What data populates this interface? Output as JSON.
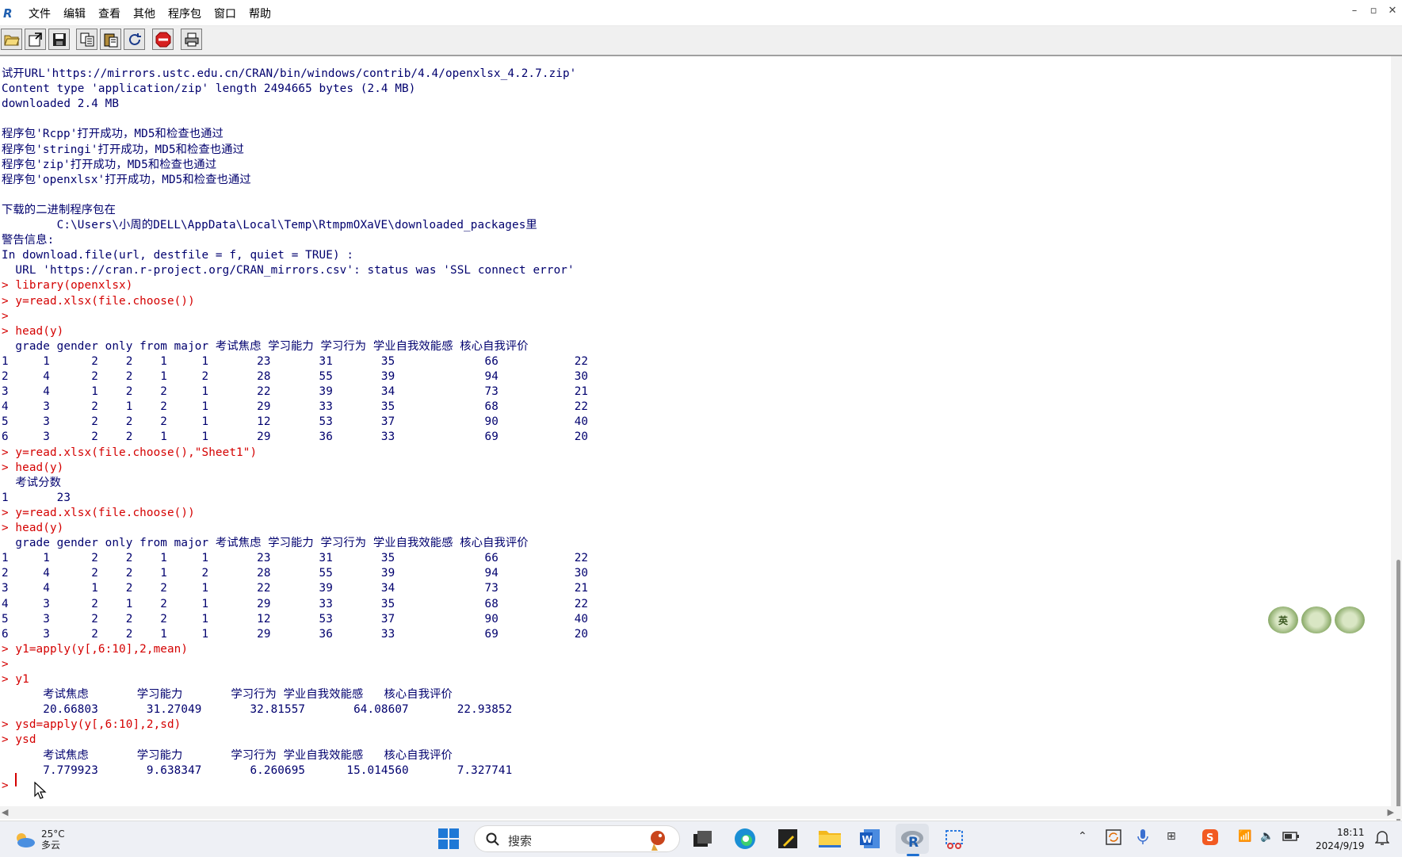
{
  "menubar": {
    "logo": "R",
    "items": [
      "文件",
      "编辑",
      "查看",
      "其他",
      "程序包",
      "窗口",
      "帮助"
    ],
    "controls": [
      "–",
      "▫",
      "✕"
    ]
  },
  "console": {
    "lines": [
      {
        "text": "试开URL'https://mirrors.ustc.edu.cn/CRAN/bin/windows/contrib/4.4/openxlsx_4.2.7.zip'",
        "type": "out"
      },
      {
        "text": "Content type 'application/zip' length 2494665 bytes (2.4 MB)",
        "type": "out"
      },
      {
        "text": "downloaded 2.4 MB",
        "type": "out"
      },
      {
        "text": "",
        "type": "out"
      },
      {
        "text": "程序包'Rcpp'打开成功，MD5和检查也通过",
        "type": "out"
      },
      {
        "text": "程序包'stringi'打开成功，MD5和检查也通过",
        "type": "out"
      },
      {
        "text": "程序包'zip'打开成功，MD5和检查也通过",
        "type": "out"
      },
      {
        "text": "程序包'openxlsx'打开成功，MD5和检查也通过",
        "type": "out"
      },
      {
        "text": "",
        "type": "out"
      },
      {
        "text": "下载的二进制程序包在",
        "type": "out"
      },
      {
        "text": "        C:\\Users\\小周的DELL\\AppData\\Local\\Temp\\RtmpmOXaVE\\downloaded_packages里",
        "type": "out"
      },
      {
        "text": "警告信息:",
        "type": "out"
      },
      {
        "text": "In download.file(url, destfile = f, quiet = TRUE) :",
        "type": "out"
      },
      {
        "text": "  URL 'https://cran.r-project.org/CRAN_mirrors.csv': status was 'SSL connect error'",
        "type": "out"
      },
      {
        "text": "> library(openxlsx)",
        "type": "cmd"
      },
      {
        "text": "> y=read.xlsx(file.choose())",
        "type": "cmd"
      },
      {
        "text": ">",
        "type": "cmd"
      },
      {
        "text": "> head(y)",
        "type": "cmd"
      },
      {
        "text": "  grade gender only from major 考试焦虑 学习能力 学习行为 学业自我效能感 核心自我评价",
        "type": "out"
      },
      {
        "text": "1     1      2    2    1     1       23       31       35             66           22",
        "type": "out"
      },
      {
        "text": "2     4      2    2    1     2       28       55       39             94           30",
        "type": "out"
      },
      {
        "text": "3     4      1    2    2     1       22       39       34             73           21",
        "type": "out"
      },
      {
        "text": "4     3      2    1    2     1       29       33       35             68           22",
        "type": "out"
      },
      {
        "text": "5     3      2    2    2     1       12       53       37             90           40",
        "type": "out"
      },
      {
        "text": "6     3      2    2    1     1       29       36       33             69           20",
        "type": "out"
      },
      {
        "text": "> y=read.xlsx(file.choose(),\"Sheet1\")",
        "type": "cmd"
      },
      {
        "text": "> head(y)",
        "type": "cmd"
      },
      {
        "text": "  考试分数",
        "type": "out"
      },
      {
        "text": "1       23",
        "type": "out"
      },
      {
        "text": "> y=read.xlsx(file.choose())",
        "type": "cmd"
      },
      {
        "text": "> head(y)",
        "type": "cmd"
      },
      {
        "text": "  grade gender only from major 考试焦虑 学习能力 学习行为 学业自我效能感 核心自我评价",
        "type": "out"
      },
      {
        "text": "1     1      2    2    1     1       23       31       35             66           22",
        "type": "out"
      },
      {
        "text": "2     4      2    2    1     2       28       55       39             94           30",
        "type": "out"
      },
      {
        "text": "3     4      1    2    2     1       22       39       34             73           21",
        "type": "out"
      },
      {
        "text": "4     3      2    1    2     1       29       33       35             68           22",
        "type": "out"
      },
      {
        "text": "5     3      2    2    2     1       12       53       37             90           40",
        "type": "out"
      },
      {
        "text": "6     3      2    2    1     1       29       36       33             69           20",
        "type": "out"
      },
      {
        "text": "> y1=apply(y[,6:10],2,mean)",
        "type": "cmd"
      },
      {
        "text": ">",
        "type": "cmd"
      },
      {
        "text": "> y1",
        "type": "cmd"
      },
      {
        "text": "      考试焦虑       学习能力       学习行为 学业自我效能感   核心自我评价",
        "type": "out"
      },
      {
        "text": "      20.66803       31.27049       32.81557       64.08607       22.93852",
        "type": "out"
      },
      {
        "text": "> ysd=apply(y[,6:10],2,sd)",
        "type": "cmd"
      },
      {
        "text": "> ysd",
        "type": "cmd"
      },
      {
        "text": "      考试焦虑       学习能力       学习行为 学业自我效能感   核心自我评价",
        "type": "out"
      },
      {
        "text": "      7.779923       9.638347       6.260695      15.014560       7.327741",
        "type": "out"
      },
      {
        "text": "> ",
        "type": "cmd"
      }
    ]
  },
  "ime": {
    "flowers": [
      "英",
      "",
      ""
    ]
  },
  "taskbar": {
    "weather_temp": "25°C",
    "weather_desc": "多云",
    "search_placeholder": "搜索",
    "time": "18:11",
    "date": "2024/9/19"
  }
}
